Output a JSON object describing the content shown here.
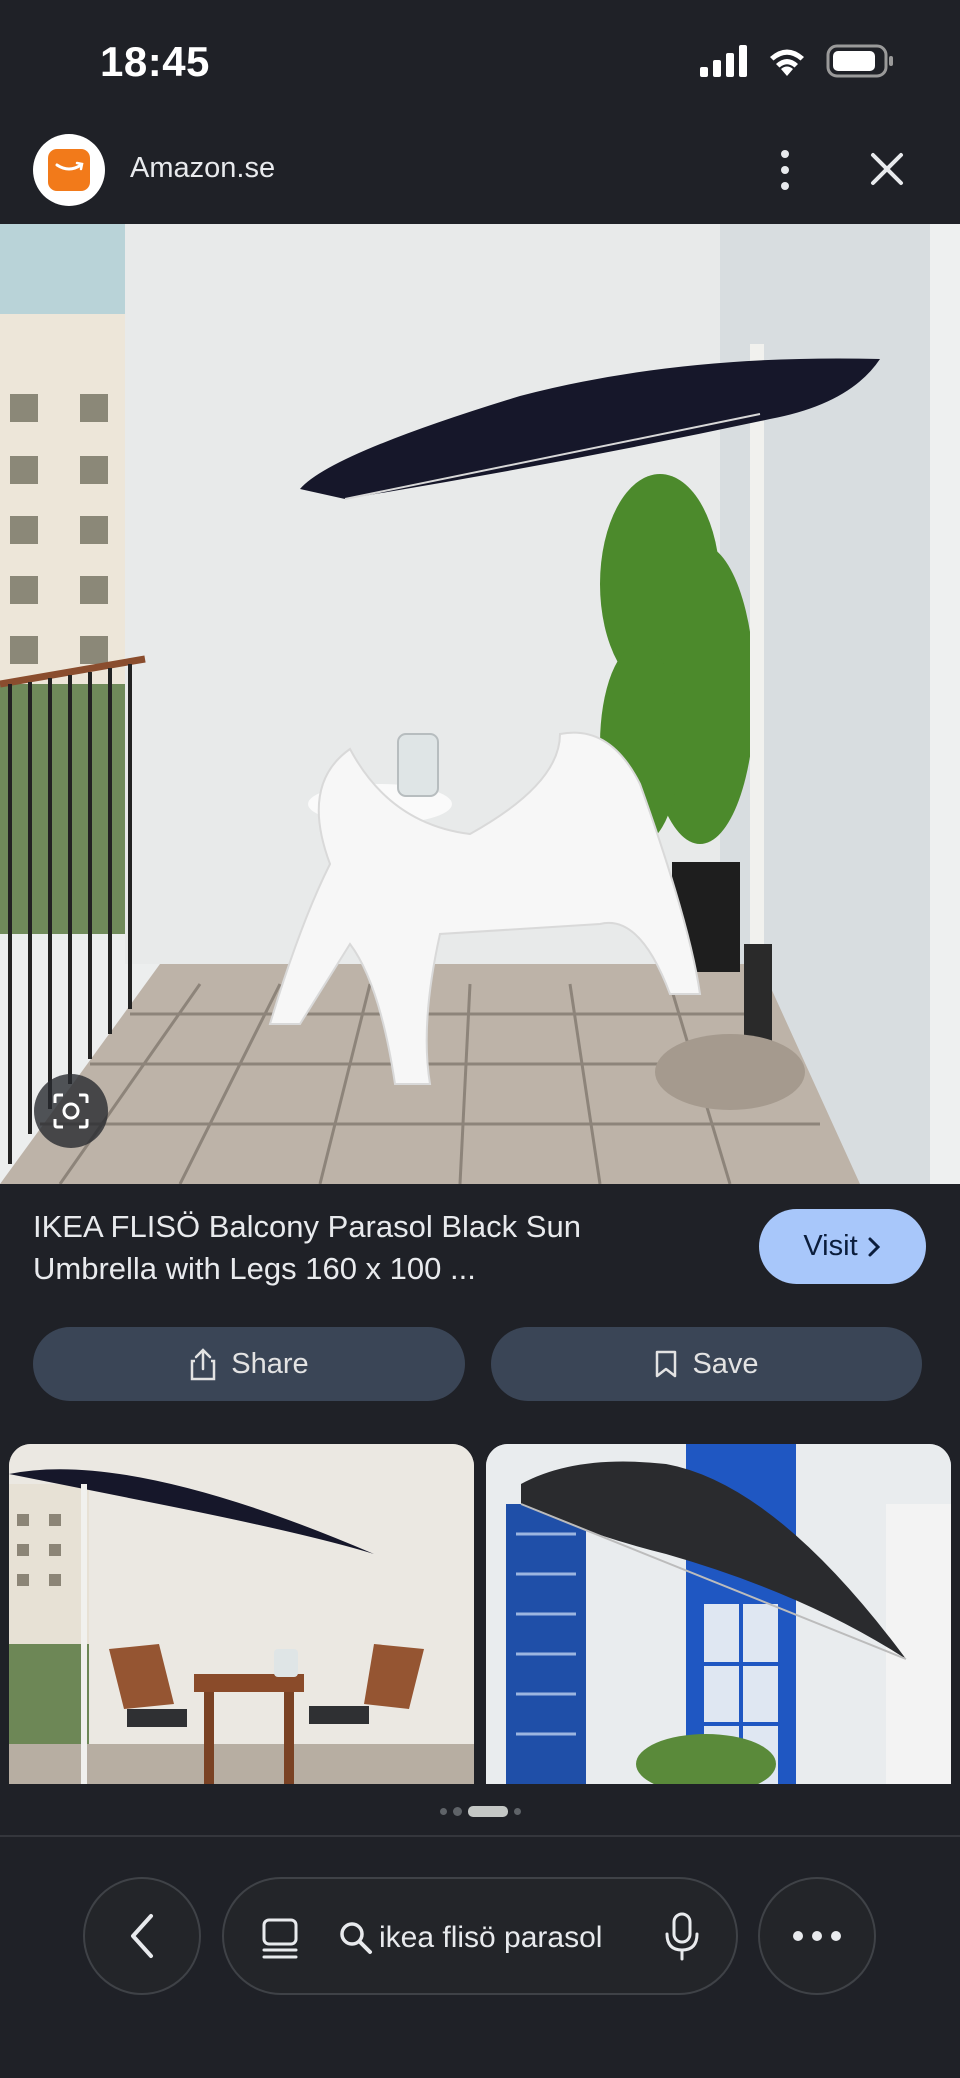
{
  "status_bar": {
    "time": "18:45",
    "icons": [
      "signal-icon",
      "wifi-icon",
      "battery-icon"
    ]
  },
  "source": {
    "name": "Amazon.se",
    "logo": "amazon-logo",
    "accent": "#f27a1a"
  },
  "result": {
    "title": "IKEA FLISÖ Balcony Parasol Black Sun Umbrella with Legs 160 x 100 ...",
    "visit_label": "Visit"
  },
  "actions": {
    "share_label": "Share",
    "save_label": "Save"
  },
  "pager": {
    "dots": 4,
    "active_index": 2
  },
  "search": {
    "query": "ikea flisö parasol"
  },
  "colors": {
    "background": "#1f2127",
    "visit_button": "#a8c7fa",
    "action_button": "#3a4556"
  }
}
